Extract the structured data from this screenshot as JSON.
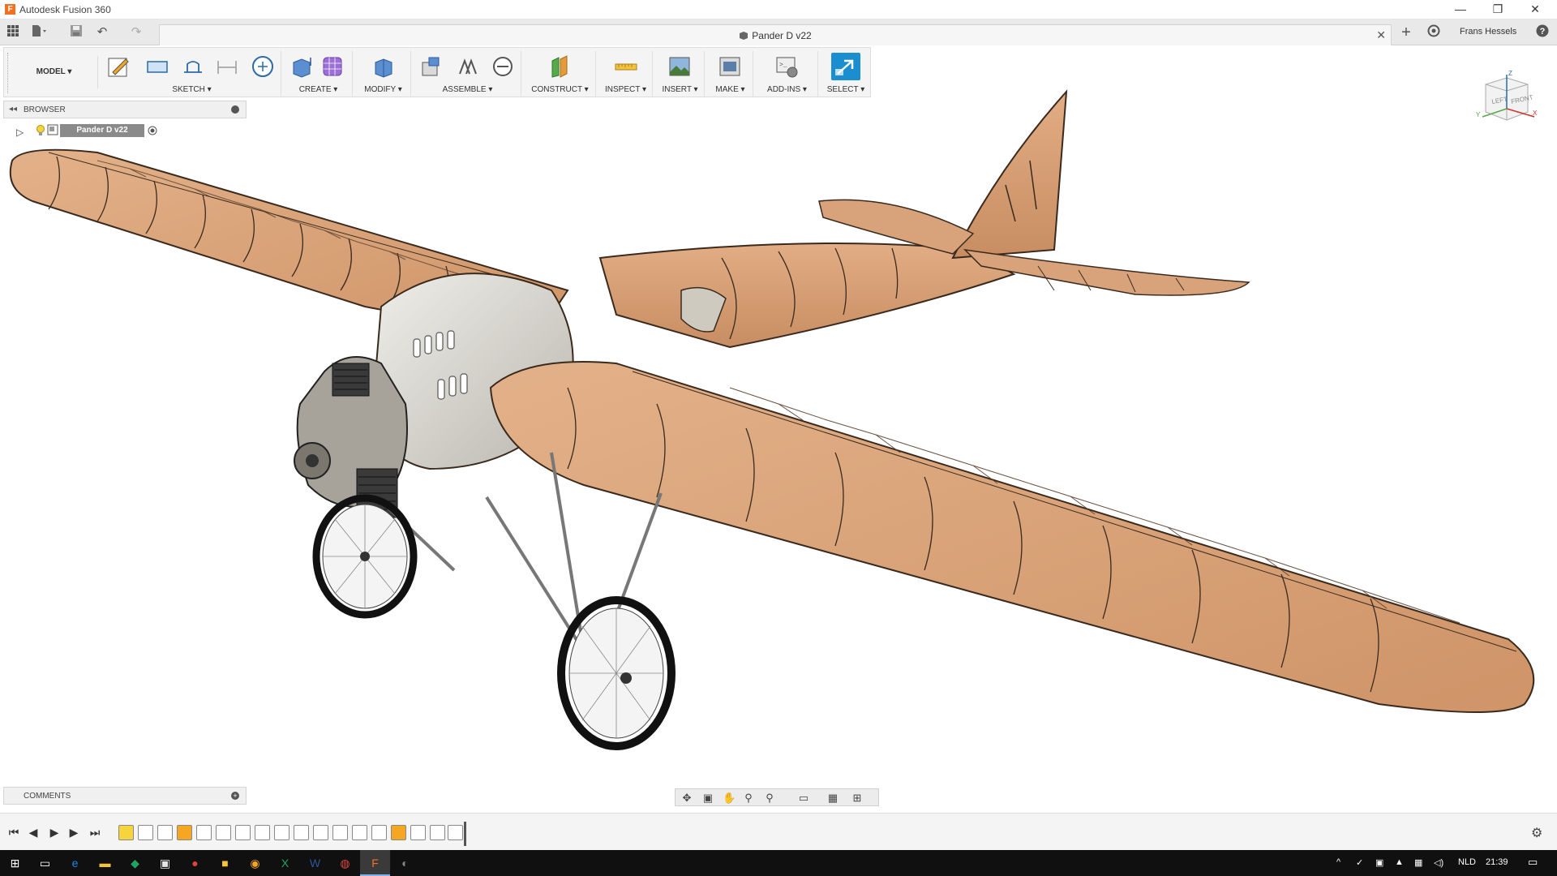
{
  "window": {
    "app_title": "Autodesk Fusion 360",
    "logo_letter": "F",
    "controls": [
      "—",
      "❐",
      "✕"
    ]
  },
  "document": {
    "tab_title": "Pander D v22",
    "close_icon": "✕"
  },
  "user": {
    "name": "Frans Hessels"
  },
  "workspace": {
    "label": "MODEL ▾"
  },
  "toolbar": {
    "groups": [
      {
        "label": "SKETCH ▾"
      },
      {
        "label": "CREATE ▾"
      },
      {
        "label": "MODIFY ▾"
      },
      {
        "label": "ASSEMBLE ▾"
      },
      {
        "label": "CONSTRUCT ▾"
      },
      {
        "label": "INSPECT ▾"
      },
      {
        "label": "INSERT ▾"
      },
      {
        "label": "MAKE ▾"
      },
      {
        "label": "ADD-INS ▾"
      },
      {
        "label": "SELECT ▾"
      }
    ]
  },
  "browser": {
    "label": "BROWSER",
    "root_item": "Pander D v22"
  },
  "comments": {
    "label": "COMMENTS"
  },
  "viewcube": {
    "top": "Z",
    "left": "LEFT",
    "front": "FRONT",
    "x": "X",
    "y": "Y"
  },
  "taskbar": {
    "language": "NLD",
    "time": "21:39"
  },
  "colors": {
    "wing": "#d9a47a",
    "wing_dark": "#3a2a1e",
    "cowling": "#d8d6cf",
    "select_active": "#1a8ecf",
    "taskbar": "#101010"
  }
}
